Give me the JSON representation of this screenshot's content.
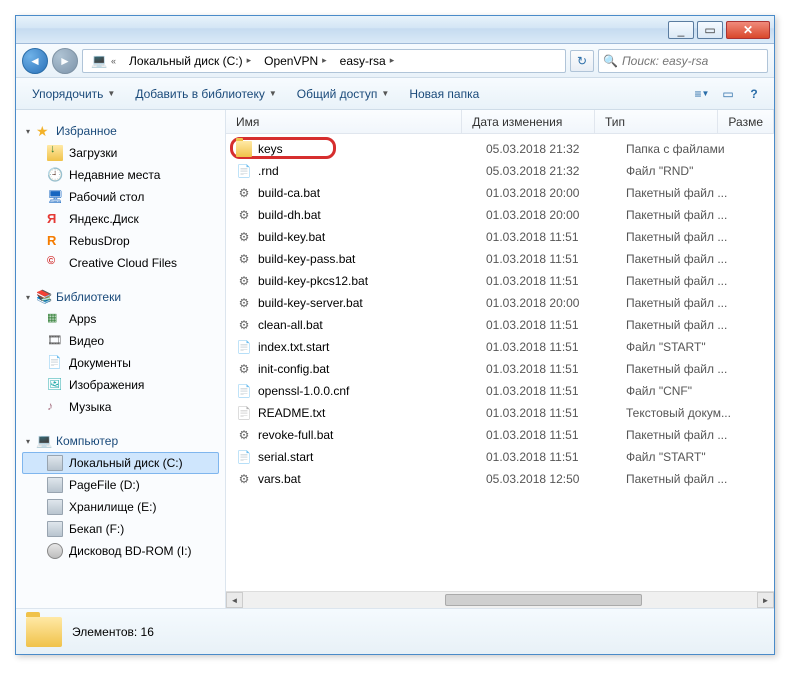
{
  "titlebar": {
    "min": "_",
    "max": "▭",
    "close": "✕"
  },
  "nav": {
    "back": "◄",
    "fwd": "►"
  },
  "breadcrumb": [
    {
      "icon": "comp",
      "label": "",
      "arrow": "«"
    },
    {
      "label": "Локальный диск (C:)",
      "arrow": "▸"
    },
    {
      "label": "OpenVPN",
      "arrow": "▸"
    },
    {
      "label": "easy-rsa",
      "arrow": "▸"
    }
  ],
  "refresh": "↻",
  "search": {
    "placeholder": "Поиск: easy-rsa"
  },
  "toolbar": {
    "organize": "Упорядочить",
    "library": "Добавить в библиотеку",
    "share": "Общий доступ",
    "newfolder": "Новая папка"
  },
  "navgroups": {
    "favorites": {
      "label": "Избранное",
      "items": [
        {
          "ic": "dl",
          "label": "Загрузки"
        },
        {
          "ic": "recent",
          "glyph": "🕘",
          "label": "Недавние места"
        },
        {
          "ic": "desk",
          "glyph": "🖥",
          "label": "Рабочий стол"
        },
        {
          "ic": "ydisk",
          "glyph": "Я",
          "label": "Яндекс.Диск"
        },
        {
          "ic": "rebus",
          "glyph": "R",
          "label": "RebusDrop"
        },
        {
          "ic": "cc",
          "glyph": "©",
          "label": "Creative Cloud Files"
        }
      ]
    },
    "libraries": {
      "label": "Библиотеки",
      "items": [
        {
          "ic": "app",
          "glyph": "▦",
          "label": "Apps"
        },
        {
          "ic": "video",
          "glyph": "🎞",
          "label": "Видео"
        },
        {
          "ic": "doc",
          "glyph": "📄",
          "label": "Документы"
        },
        {
          "ic": "img",
          "glyph": "🖼",
          "label": "Изображения"
        },
        {
          "ic": "music",
          "glyph": "♪",
          "label": "Музыка"
        }
      ]
    },
    "computer": {
      "label": "Компьютер",
      "items": [
        {
          "ic": "drive",
          "label": "Локальный диск (C:)",
          "sel": true
        },
        {
          "ic": "drive",
          "label": "PageFile (D:)"
        },
        {
          "ic": "drive",
          "label": "Хранилище (E:)"
        },
        {
          "ic": "drive",
          "label": "Бекап (F:)"
        },
        {
          "ic": "rom",
          "label": "Дисковод BD-ROM (I:)"
        }
      ]
    }
  },
  "columns": {
    "name": "Имя",
    "date": "Дата изменения",
    "type": "Тип",
    "size": "Разме"
  },
  "files": [
    {
      "ic": "folder",
      "name": "keys",
      "date": "05.03.2018 21:32",
      "type": "Папка с файлами"
    },
    {
      "ic": "file",
      "name": ".rnd",
      "date": "05.03.2018 21:32",
      "type": "Файл \"RND\""
    },
    {
      "ic": "bat",
      "name": "build-ca.bat",
      "date": "01.03.2018 20:00",
      "type": "Пакетный файл ..."
    },
    {
      "ic": "bat",
      "name": "build-dh.bat",
      "date": "01.03.2018 20:00",
      "type": "Пакетный файл ..."
    },
    {
      "ic": "bat",
      "name": "build-key.bat",
      "date": "01.03.2018 11:51",
      "type": "Пакетный файл ..."
    },
    {
      "ic": "bat",
      "name": "build-key-pass.bat",
      "date": "01.03.2018 11:51",
      "type": "Пакетный файл ..."
    },
    {
      "ic": "bat",
      "name": "build-key-pkcs12.bat",
      "date": "01.03.2018 11:51",
      "type": "Пакетный файл ..."
    },
    {
      "ic": "bat",
      "name": "build-key-server.bat",
      "date": "01.03.2018 20:00",
      "type": "Пакетный файл ..."
    },
    {
      "ic": "bat",
      "name": "clean-all.bat",
      "date": "01.03.2018 11:51",
      "type": "Пакетный файл ..."
    },
    {
      "ic": "file",
      "name": "index.txt.start",
      "date": "01.03.2018 11:51",
      "type": "Файл \"START\""
    },
    {
      "ic": "bat",
      "name": "init-config.bat",
      "date": "01.03.2018 11:51",
      "type": "Пакетный файл ..."
    },
    {
      "ic": "file",
      "name": "openssl-1.0.0.cnf",
      "date": "01.03.2018 11:51",
      "type": "Файл \"CNF\""
    },
    {
      "ic": "txt",
      "name": "README.txt",
      "date": "01.03.2018 11:51",
      "type": "Текстовый докум..."
    },
    {
      "ic": "bat",
      "name": "revoke-full.bat",
      "date": "01.03.2018 11:51",
      "type": "Пакетный файл ..."
    },
    {
      "ic": "file",
      "name": "serial.start",
      "date": "01.03.2018 11:51",
      "type": "Файл \"START\""
    },
    {
      "ic": "bat",
      "name": "vars.bat",
      "date": "05.03.2018 12:50",
      "type": "Пакетный файл ..."
    }
  ],
  "status": {
    "text": "Элементов: 16"
  }
}
